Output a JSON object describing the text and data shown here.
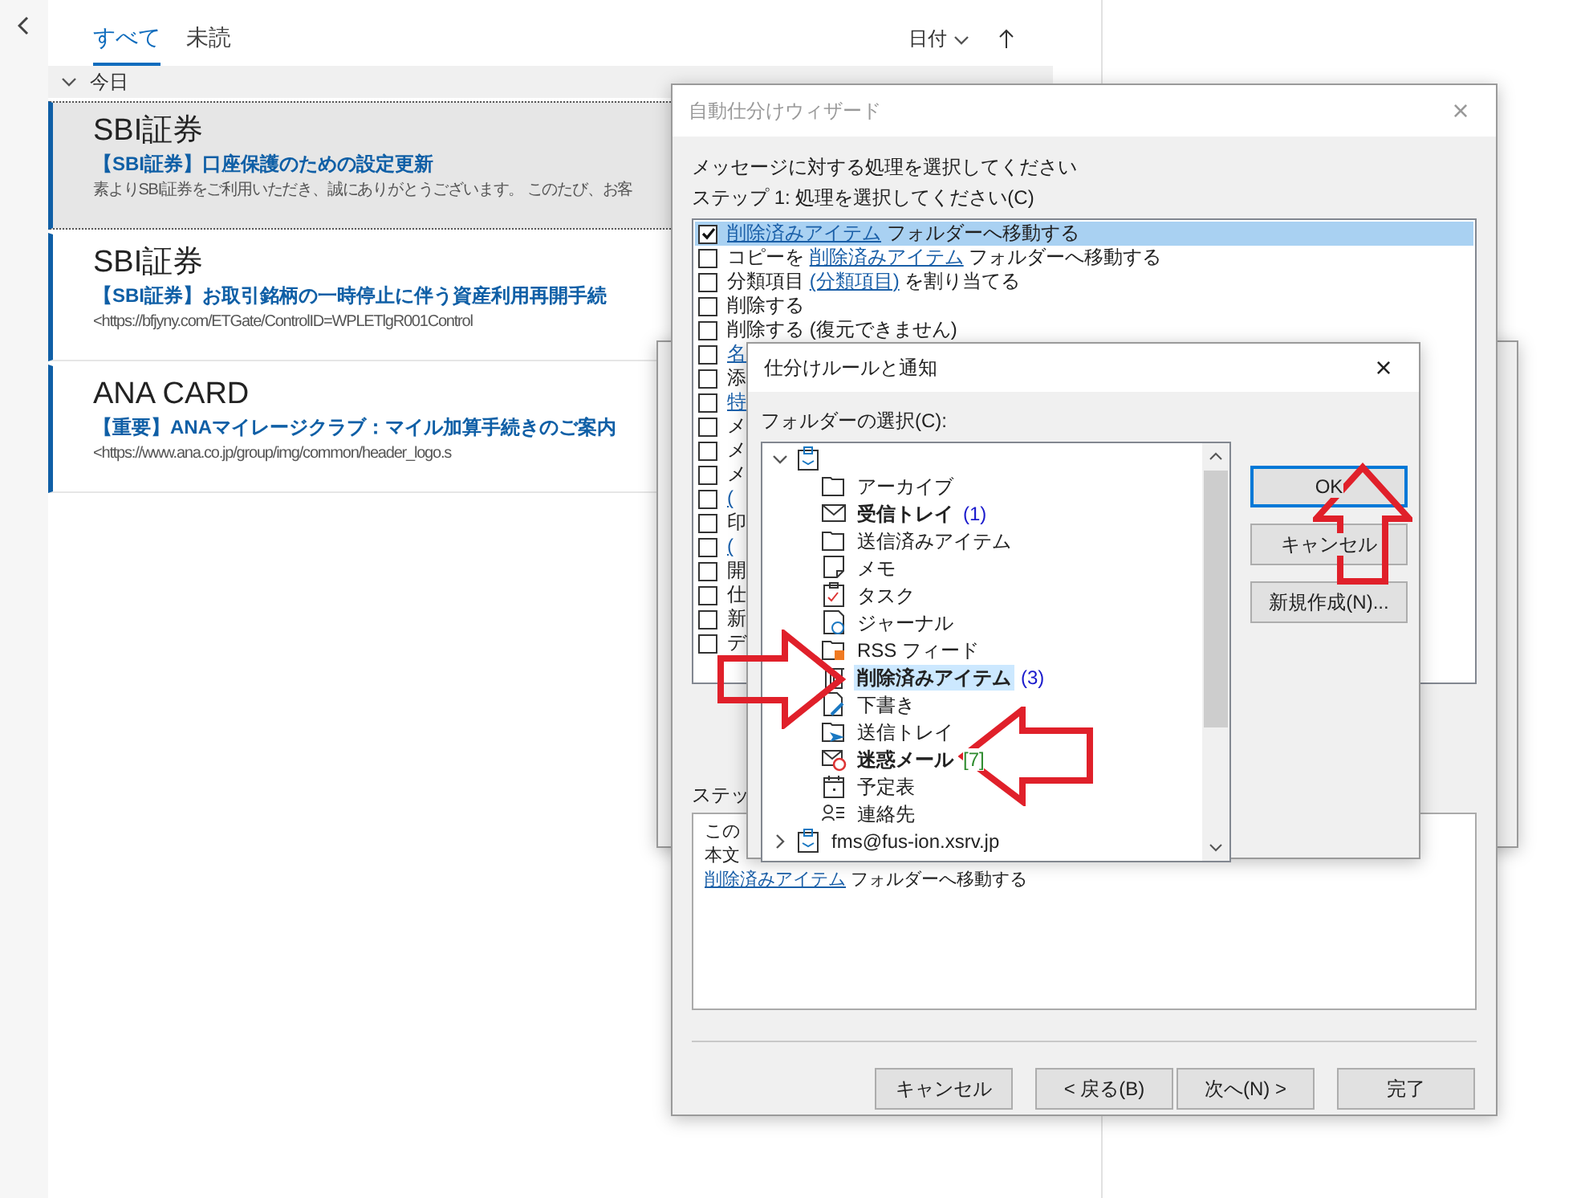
{
  "mail_list": {
    "tabs": [
      {
        "label": "すべて",
        "selected": true
      },
      {
        "label": "未読",
        "selected": false
      }
    ],
    "sort": {
      "label": "日付"
    },
    "group": {
      "label": "今日",
      "expanded": true
    },
    "messages": [
      {
        "sender": "SBI証券",
        "subject": "【SBI証券】口座保護のための設定更新",
        "preview": "素よりSBI証券をご利用いただき、誠にありがとうございます。 このたび、お客",
        "selected": true
      },
      {
        "sender": "SBI証券",
        "subject": "【SBI証券】お取引銘柄の一時停止に伴う資産利用再開手続",
        "preview": "<https://bfjyny.com/ETGate/ControlID=WPLETlgR001Control",
        "selected": false
      },
      {
        "sender": "ANA CARD",
        "subject": "【重要】ANAマイレージクラブ：マイル加算手続きのご案内",
        "preview": "<https://www.ana.co.jp/group/img/common/header_logo.s",
        "selected": false
      }
    ]
  },
  "wizard": {
    "title": "自動仕分けウィザード",
    "close": "×",
    "instruction": "メッセージに対する処理を選択してください",
    "step1": "ステップ 1: 処理を選択してください(C)",
    "actions": [
      {
        "checked": true,
        "selected": true,
        "parts": [
          {
            "text": "削除済みアイテム",
            "link": true
          },
          {
            "text": " フォルダーへ移動する",
            "link": false
          }
        ]
      },
      {
        "checked": false,
        "selected": false,
        "parts": [
          {
            "text": "コピーを ",
            "link": false
          },
          {
            "text": "削除済みアイテム",
            "link": true
          },
          {
            "text": " フォルダーへ移動する",
            "link": false
          }
        ]
      },
      {
        "checked": false,
        "selected": false,
        "parts": [
          {
            "text": "分類項目 ",
            "link": false
          },
          {
            "text": "(分類項目)",
            "link": true
          },
          {
            "text": " を割り当てる",
            "link": false
          }
        ]
      },
      {
        "checked": false,
        "selected": false,
        "parts": [
          {
            "text": "削除する",
            "link": false
          }
        ]
      },
      {
        "checked": false,
        "selected": false,
        "parts": [
          {
            "text": "削除する (復元できません)",
            "link": false
          }
        ]
      },
      {
        "checked": false,
        "selected": false,
        "parts": [
          {
            "text": "名",
            "link": true
          }
        ]
      },
      {
        "checked": false,
        "selected": false,
        "parts": [
          {
            "text": "添",
            "link": false
          }
        ]
      },
      {
        "checked": false,
        "selected": false,
        "parts": [
          {
            "text": "特",
            "link": true
          }
        ]
      },
      {
        "checked": false,
        "selected": false,
        "parts": [
          {
            "text": "メ",
            "link": false
          }
        ]
      },
      {
        "checked": false,
        "selected": false,
        "parts": [
          {
            "text": "メ",
            "link": false
          }
        ]
      },
      {
        "checked": false,
        "selected": false,
        "parts": [
          {
            "text": "メ",
            "link": false
          }
        ]
      },
      {
        "checked": false,
        "selected": false,
        "parts": [
          {
            "text": "(",
            "link": true
          }
        ]
      },
      {
        "checked": false,
        "selected": false,
        "parts": [
          {
            "text": "印",
            "link": false
          }
        ]
      },
      {
        "checked": false,
        "selected": false,
        "parts": [
          {
            "text": "(",
            "link": true
          }
        ]
      },
      {
        "checked": false,
        "selected": false,
        "parts": [
          {
            "text": "開",
            "link": false
          }
        ]
      },
      {
        "checked": false,
        "selected": false,
        "parts": [
          {
            "text": "仕",
            "link": false
          }
        ]
      },
      {
        "checked": false,
        "selected": false,
        "parts": [
          {
            "text": "新",
            "link": false
          }
        ]
      },
      {
        "checked": false,
        "selected": false,
        "parts": [
          {
            "text": "デ",
            "link": false
          }
        ]
      }
    ],
    "step2": "ステッ",
    "description": [
      {
        "parts": [
          {
            "text": "この",
            "link": false
          }
        ]
      },
      {
        "parts": [
          {
            "text": "本文",
            "link": false
          }
        ]
      },
      {
        "parts": [
          {
            "text": "削除済みアイテム",
            "link": true
          },
          {
            "text": " フォルダーへ移動する",
            "link": false
          }
        ]
      }
    ],
    "buttons": [
      "キャンセル",
      "< 戻る(B)",
      "次へ(N) >",
      "完了"
    ]
  },
  "folder_dialog": {
    "title": "仕分けルールと通知",
    "close": "×",
    "label": "フォルダーの選択(C):",
    "tree": [
      {
        "kind": "account",
        "expanded": true,
        "children": [
          {
            "kind": "folder",
            "label": "アーカイブ",
            "bold": false,
            "selected": false
          },
          {
            "kind": "inbox",
            "label": "受信トレイ",
            "count": "(1)",
            "color": "#1a1acc",
            "bold": true,
            "selected": false
          },
          {
            "kind": "folder",
            "label": "送信済みアイテム",
            "bold": false,
            "selected": false
          },
          {
            "kind": "note",
            "label": "メモ",
            "bold": false,
            "selected": false
          },
          {
            "kind": "task",
            "label": "タスク",
            "bold": false,
            "selected": false
          },
          {
            "kind": "journal",
            "label": "ジャーナル",
            "bold": false,
            "selected": false
          },
          {
            "kind": "rss",
            "label": "RSS フィード",
            "bold": false,
            "selected": false
          },
          {
            "kind": "trash",
            "label": "削除済みアイテム",
            "count": "(3)",
            "color": "#1a1acc",
            "bold": true,
            "selected": true
          },
          {
            "kind": "draft",
            "label": "下書き",
            "bold": false,
            "selected": false
          },
          {
            "kind": "outbox",
            "label": "送信トレイ",
            "bold": false,
            "selected": false
          },
          {
            "kind": "junk",
            "label": "迷惑メール",
            "count": "[7]",
            "color": "#2e8b2e",
            "bold": true,
            "selected": false
          },
          {
            "kind": "calendar",
            "label": "予定表",
            "bold": false,
            "selected": false
          },
          {
            "kind": "contacts",
            "label": "連絡先",
            "bold": false,
            "selected": false
          }
        ]
      },
      {
        "kind": "account",
        "label": "fms@fus-ion.xsrv.jp",
        "expanded": false,
        "bold": false,
        "selected": false
      }
    ],
    "buttons": [
      {
        "label": "OK",
        "default": true
      },
      {
        "label": "キャンセル",
        "default": false
      },
      {
        "label": "新規作成(N)...",
        "default": false
      }
    ]
  }
}
